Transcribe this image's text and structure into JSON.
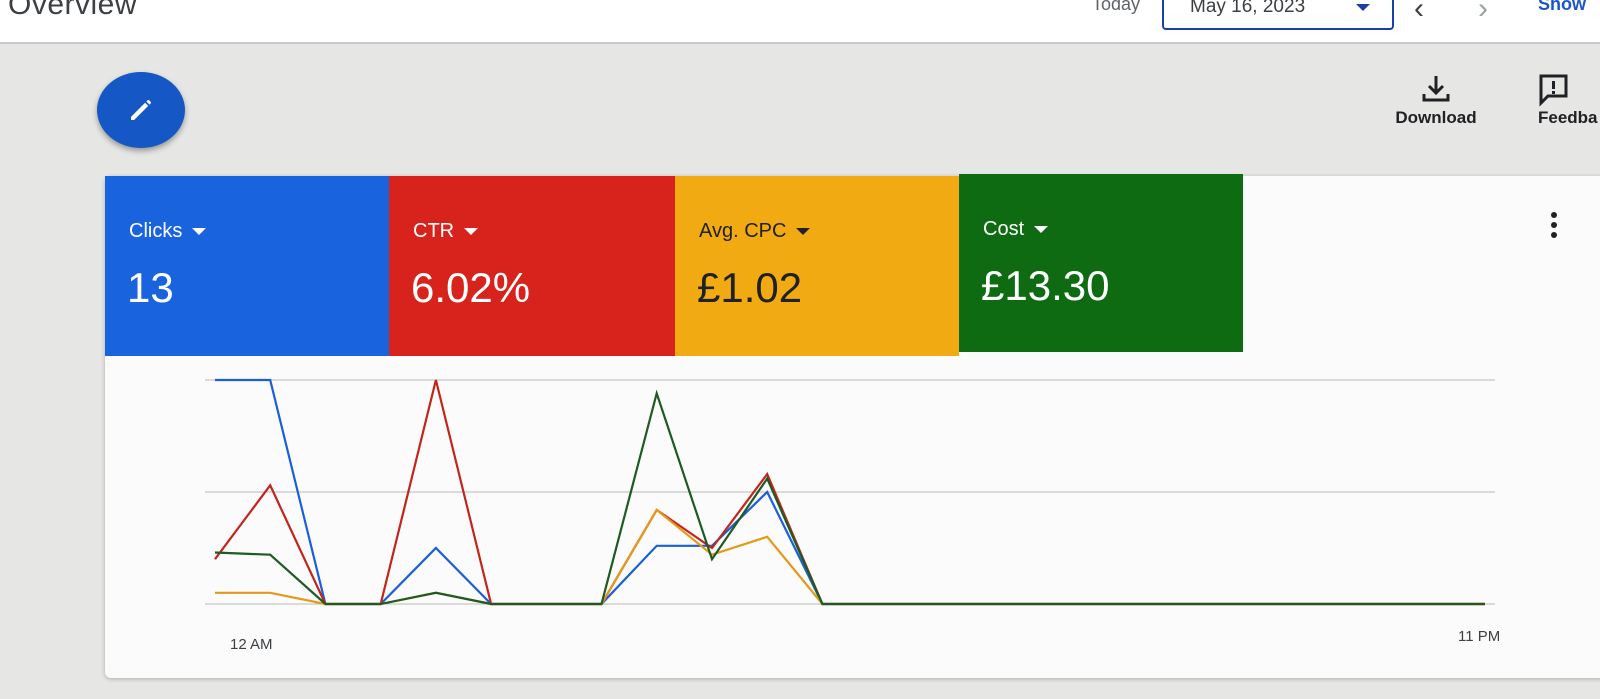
{
  "header": {
    "title": "Overview",
    "today_label": "Today",
    "date_value": "May 16, 2023",
    "prev_icon": "chevron-left-icon",
    "next_icon": "chevron-right-icon",
    "show_label": "Show"
  },
  "toolbar": {
    "edit_icon": "pencil-icon",
    "download_label": "Download",
    "feedback_label": "Feedba"
  },
  "metrics": [
    {
      "name": "Clicks",
      "value": "13",
      "color": "#1a63de"
    },
    {
      "name": "CTR",
      "value": "6.02%",
      "color": "#d8231c"
    },
    {
      "name": "Avg. CPC",
      "value": "£1.02",
      "color": "#f2aa12"
    },
    {
      "name": "Cost",
      "value": "£13.30",
      "color": "#0f6b12"
    }
  ],
  "chart_data": {
    "type": "line",
    "x_start_label": "12 AM",
    "x_end_label": "11 PM",
    "x_hours": [
      0,
      1,
      2,
      3,
      4,
      5,
      6,
      7,
      8,
      9,
      10,
      11,
      12,
      13,
      14,
      15,
      16,
      17,
      18,
      19,
      20,
      21,
      22,
      23
    ],
    "grid": true,
    "gridline_count": 3,
    "series": [
      {
        "color": "#1a5fd8",
        "values": [
          1.0,
          1.0,
          0.0,
          0.0,
          0.25,
          0.0,
          0.0,
          0.0,
          0.26,
          0.26,
          0.5,
          0,
          0,
          0,
          0,
          0,
          0,
          0,
          0,
          0,
          0,
          0,
          0,
          0
        ]
      },
      {
        "color": "#c0261c",
        "values": [
          0.2,
          0.53,
          0.0,
          0.0,
          1.0,
          0.0,
          0.0,
          0.0,
          0.42,
          0.25,
          0.58,
          0,
          0,
          0,
          0,
          0,
          0,
          0,
          0,
          0,
          0,
          0,
          0,
          0
        ]
      },
      {
        "color": "#e39a1a",
        "values": [
          0.05,
          0.05,
          0.0,
          0.0,
          0.05,
          0.0,
          0.0,
          0.0,
          0.42,
          0.22,
          0.3,
          0,
          0,
          0,
          0,
          0,
          0,
          0,
          0,
          0,
          0,
          0,
          0,
          0
        ]
      },
      {
        "color": "#1e5a22",
        "values": [
          0.23,
          0.22,
          0.0,
          0.0,
          0.05,
          0.0,
          0.0,
          0.0,
          0.94,
          0.2,
          0.56,
          0,
          0,
          0,
          0,
          0,
          0,
          0,
          0,
          0,
          0,
          0,
          0,
          0
        ]
      }
    ]
  }
}
